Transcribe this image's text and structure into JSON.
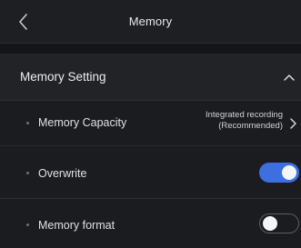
{
  "header": {
    "title": "Memory",
    "back_icon": "chevron-left-icon"
  },
  "section": {
    "title": "Memory Setting",
    "expanded": true,
    "collapse_icon": "chevron-up-icon"
  },
  "settings": {
    "capacity": {
      "label": "Memory Capacity",
      "value_line1": "Integrated recording",
      "value_line2": "(Recommended)",
      "icon": "chevron-right-icon"
    },
    "overwrite": {
      "label": "Overwrite",
      "enabled": true
    },
    "format": {
      "label": "Memory format",
      "enabled": false
    }
  },
  "colors": {
    "background": "#18191c",
    "header": "#1d1f22",
    "section_header": "#212327",
    "toggle_on": "#3e6fe0",
    "toggle_off_border": "#5b5e64",
    "text": "#e6e7ea"
  }
}
